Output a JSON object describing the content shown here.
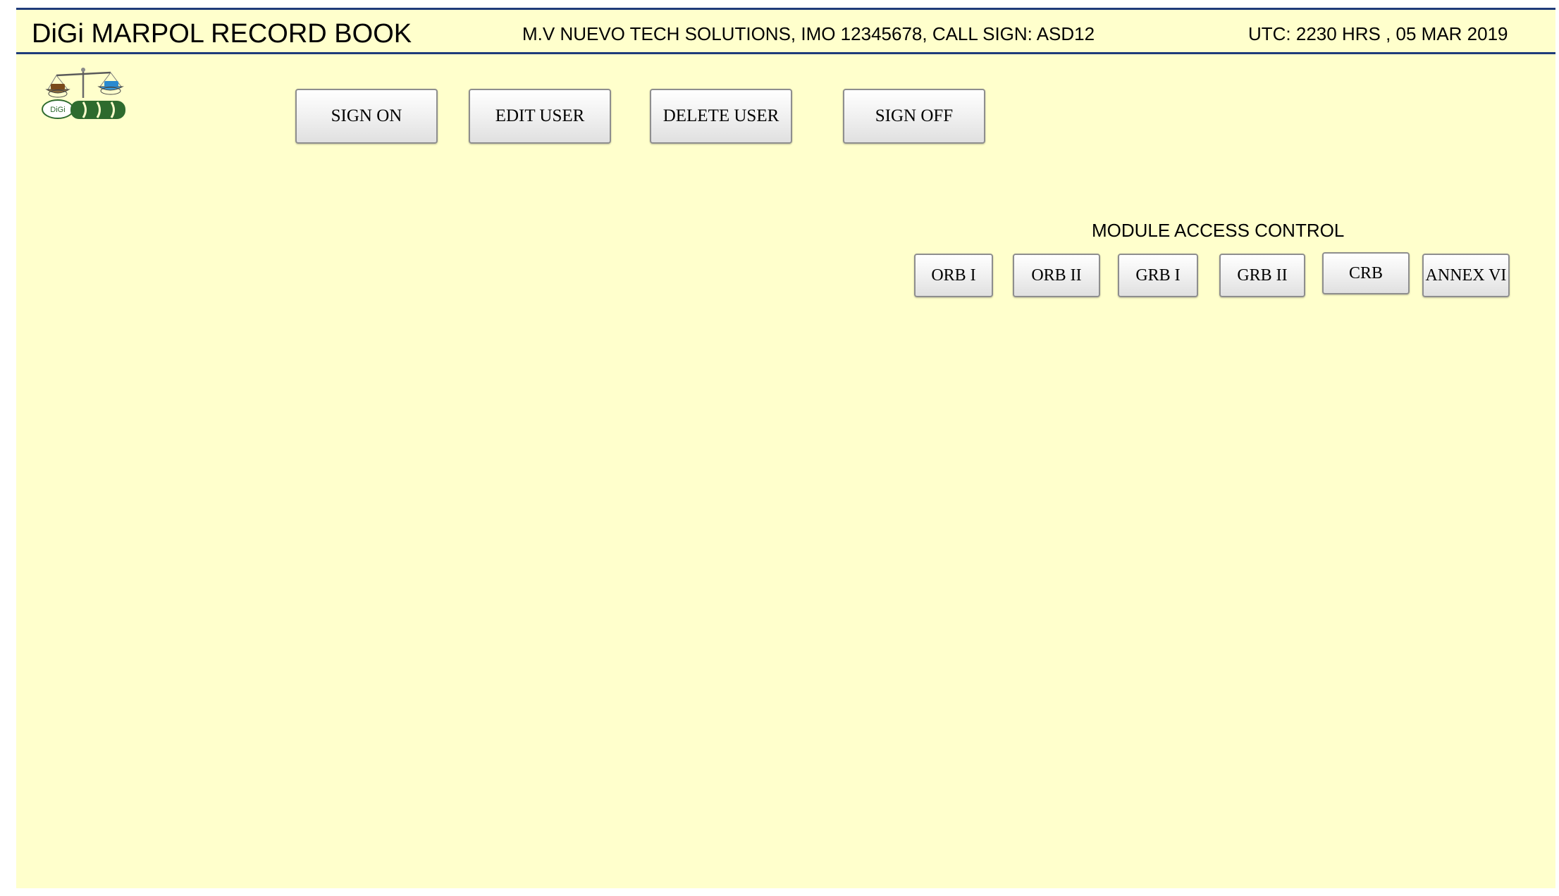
{
  "header": {
    "app_title": "DiGi MARPOL RECORD BOOK",
    "vessel_info": "M.V NUEVO TECH SOLUTIONS, IMO 12345678, CALL SIGN: ASD12",
    "utc": "UTC: 2230 HRS , 05 MAR 2019"
  },
  "logo": {
    "icon": "balance-scale-logo-icon",
    "left_pan_label": "OIL",
    "right_pan_label": "WATER",
    "brand": "DiGi"
  },
  "user_actions": {
    "sign_on": "SIGN ON",
    "edit_user": "EDIT USER",
    "delete_user": "DELETE USER",
    "sign_off": "SIGN OFF"
  },
  "module_access": {
    "title": "MODULE ACCESS CONTROL",
    "modules": [
      "ORB I",
      "ORB II",
      "GRB I",
      "GRB II",
      "CRB",
      "ANNEX VI"
    ]
  },
  "colors": {
    "background": "#ffffcc",
    "header_border": "#1f3b7a",
    "logo_green": "#2e6b2e"
  }
}
